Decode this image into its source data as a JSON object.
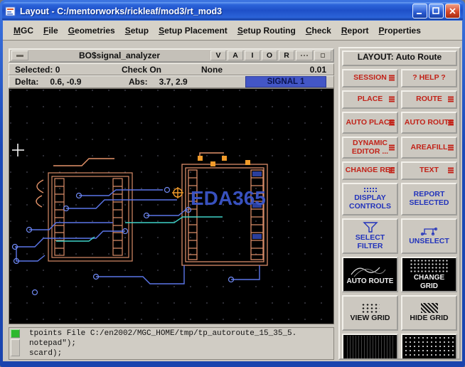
{
  "window": {
    "title": "Layout - C:/mentorworks/rickleaf/mod3/rt_mod3"
  },
  "menu": {
    "items": [
      "MGC",
      "File",
      "Geometries",
      "Setup",
      "Setup Placement",
      "Setup Routing",
      "Check",
      "Report",
      "Properties"
    ]
  },
  "viewport": {
    "title": "BO$signal_analyzer",
    "view_buttons": [
      "V",
      "A",
      "I",
      "O",
      "R"
    ]
  },
  "status": {
    "selected": "Selected: 0",
    "check_label": "Check On",
    "check_value": "None",
    "grid_value": "0.01",
    "delta_label": "Delta:",
    "delta_value": "0.6, -0.9",
    "abs_label": "Abs:",
    "abs_value": "3.7, 2.9",
    "signal": "SIGNAL 1"
  },
  "canvas": {
    "watermark": "EDA365"
  },
  "palette": {
    "title": "LAYOUT: Auto Route",
    "buttons": [
      {
        "label": "SESSION"
      },
      {
        "label": "? HELP ?"
      },
      {
        "label": "PLACE"
      },
      {
        "label": "ROUTE"
      },
      {
        "label": "AUTO PLACE"
      },
      {
        "label": "AUTO ROUTE"
      },
      {
        "label": "DYNAMIC EDITOR ..."
      },
      {
        "label": "AREAFILL"
      },
      {
        "label": "CHANGE REF"
      },
      {
        "label": "TEXT"
      },
      {
        "label": "DISPLAY CONTROLS"
      },
      {
        "label": "REPORT SELECTED"
      },
      {
        "label": "SELECT FILTER"
      },
      {
        "label": "UNSELECT"
      },
      {
        "label": "AUTO ROUTE"
      },
      {
        "label": "CHANGE GRID"
      },
      {
        "label": "VIEW GRID"
      },
      {
        "label": "HIDE GRID"
      }
    ]
  },
  "console": {
    "lines": [
      "tpoints File C:/en2002/MGC_HOME/tmp/tp_autoroute_15_35_5.",
      "notepad\");",
      "scard);"
    ]
  },
  "colors": {
    "accent_red": "#c22218",
    "accent_blue": "#2233bb",
    "signal_badge_bg": "#4356c6",
    "canvas_bg": "#000000",
    "trace_blue": "#5b76e8",
    "trace_cyan": "#3fd2c8",
    "footprint_salmon": "#d98c68"
  }
}
